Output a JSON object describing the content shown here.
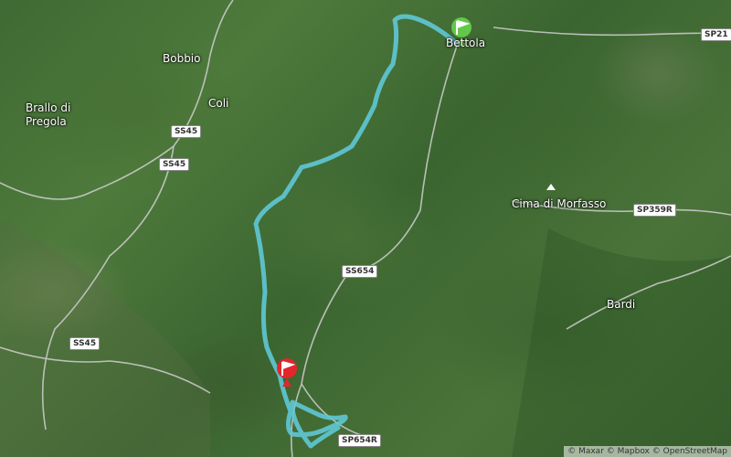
{
  "places": {
    "bobbio": "Bobbio",
    "coli": "Coli",
    "brallo": "Brallo di\nPregola",
    "bettola": "Bettola",
    "cima": "Cima di Morfasso",
    "bardi": "Bardi"
  },
  "roads": {
    "sp21": "SP21",
    "ss45_a": "SS45",
    "ss45_b": "SS45",
    "ss45_c": "SS45",
    "sp359r": "SP359R",
    "ss654": "SS654",
    "sp654r": "SP654R"
  },
  "route": {
    "color": "#5fc8d6"
  },
  "markers": {
    "start_color": "#63c84a",
    "end_color": "#e3262b"
  },
  "attribution": "© Maxar © Mapbox © OpenStreetMap"
}
